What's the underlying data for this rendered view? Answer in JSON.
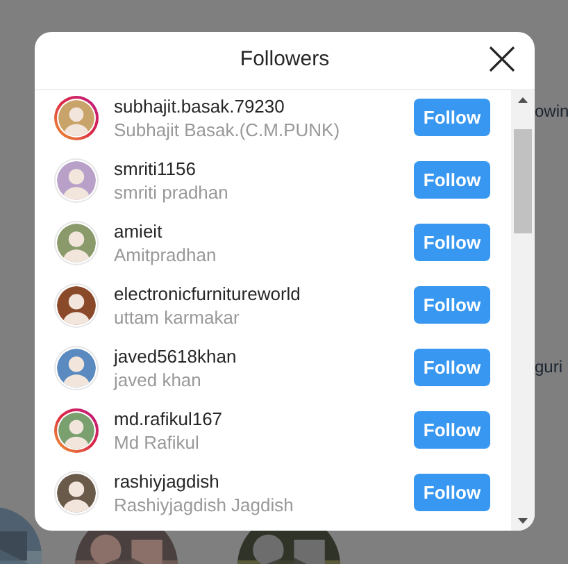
{
  "background": {
    "texts": [
      "owin",
      "guri"
    ],
    "pictures": [
      {
        "kind": "picture"
      },
      {
        "kind": "picture"
      },
      {
        "kind": "picture"
      }
    ]
  },
  "modal": {
    "title": "Followers",
    "followers": [
      {
        "username": "subhajit.basak.79230",
        "full_name": "Subhajit Basak.(C.M.PUNK)",
        "story_ring": true,
        "button": "Follow"
      },
      {
        "username": "smriti1156",
        "full_name": "smriti pradhan",
        "story_ring": false,
        "button": "Follow"
      },
      {
        "username": "amieit",
        "full_name": "Amitpradhan",
        "story_ring": false,
        "button": "Follow"
      },
      {
        "username": "electronicfurnitureworld",
        "full_name": "uttam karmakar",
        "story_ring": false,
        "button": "Follow"
      },
      {
        "username": "javed5618khan",
        "full_name": "javed khan",
        "story_ring": false,
        "button": "Follow"
      },
      {
        "username": "md.rafikul167",
        "full_name": "Md Rafikul",
        "story_ring": true,
        "button": "Follow"
      },
      {
        "username": "rashiyjagdish",
        "full_name": "Rashiyjagdish Jagdish",
        "story_ring": false,
        "button": "Follow"
      }
    ]
  }
}
